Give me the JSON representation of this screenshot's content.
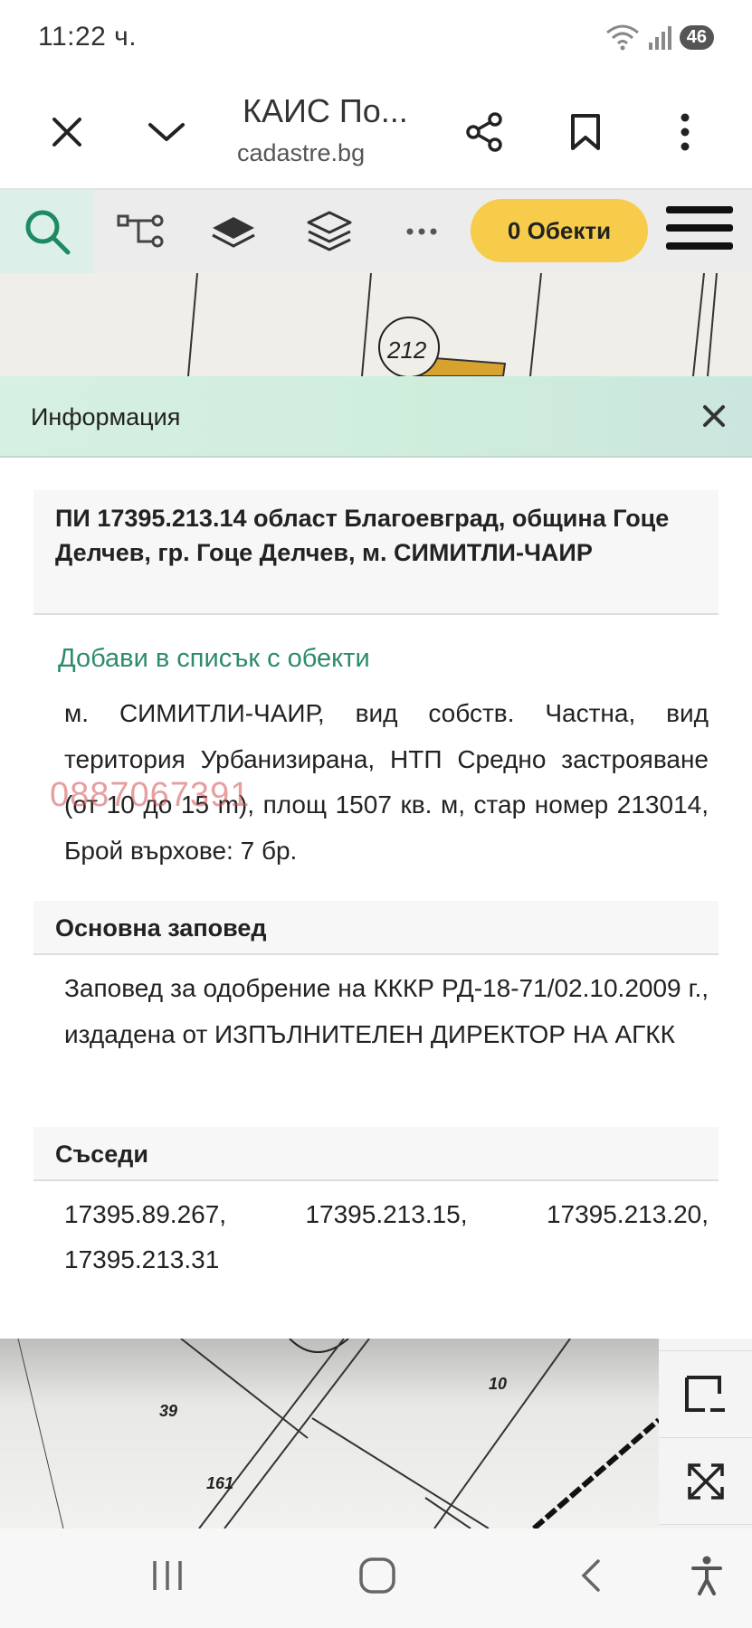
{
  "status": {
    "time": "11:22 ч.",
    "battery": "46"
  },
  "browser": {
    "title": "КАИС По...",
    "url": "cadastre.bg"
  },
  "toolbar": {
    "objects_label": "0 Обекти"
  },
  "map": {
    "top_label": "212",
    "labels": [
      "39",
      "10",
      "161"
    ]
  },
  "info": {
    "title": "Информация",
    "parcel_heading": "ПИ 17395.213.14 област Благоевград, община Гоце Делчев, гр. Гоце Делчев, м. СИМИТЛИ-ЧАИР",
    "add_link": "Добави в списък с обекти",
    "description": "м. СИМИТЛИ-ЧАИР, вид собств. Частна, вид територия Урбанизирана, НТП Средно застрояване (от 10 до 15 m), площ 1507 кв. м, стар номер 213014, Брой върхове: 7 бр.",
    "watermark": "0887067391",
    "order_heading": "Основна заповед",
    "order_text": "Заповед за одобрение на КККР РД-18-71/02.10.2009 г., издадена от ИЗПЪЛНИТЕЛЕН ДИРЕКТОР НА АГКК",
    "neighbors_heading": "Съседи",
    "neighbors": [
      "17395.89.267,",
      "17395.213.15,",
      "17395.213.20,",
      "17395.213.31"
    ]
  }
}
